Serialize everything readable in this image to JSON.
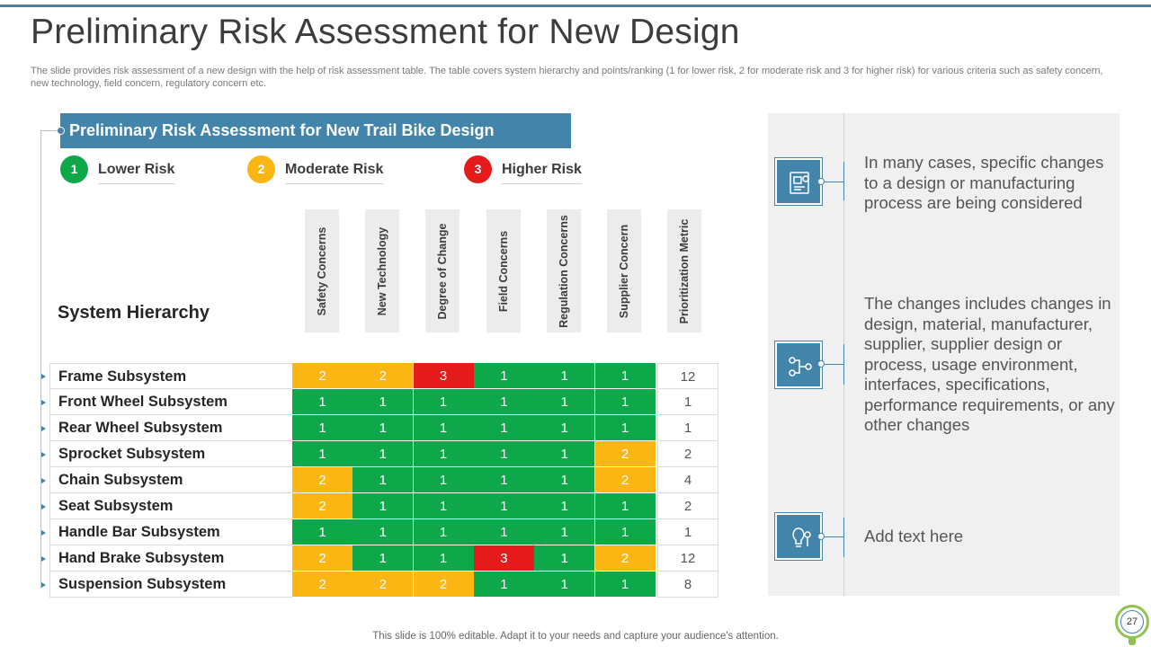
{
  "slide": {
    "title": "Preliminary Risk Assessment for New Design",
    "description": "The slide provides risk assessment of a new design with the help of risk assessment table. The table covers system hierarchy and points/ranking (1 for lower risk, 2 for moderate risk and 3 for higher risk) for various criteria such as safety concern, new technology, field concern, regulatory concern etc.",
    "footer": "This slide is 100% editable. Adapt it to your needs and capture your audience's attention.",
    "page_number": "27"
  },
  "table": {
    "banner": "Preliminary Risk Assessment for New Trail Bike Design",
    "legend": [
      {
        "number": "1",
        "label": "Lower Risk",
        "color": "#0ea84a"
      },
      {
        "number": "2",
        "label": "Moderate Risk",
        "color": "#fbb614"
      },
      {
        "number": "3",
        "label": "Higher Risk",
        "color": "#e51b1b"
      }
    ],
    "hierarchy_title": "System Hierarchy",
    "columns": [
      "Safety Concerns",
      "New Technology",
      "Degree of Change",
      "Field Concerns",
      "Regulation Concerns",
      "Supplier Concern",
      "Prioritization Metric"
    ],
    "rows": [
      {
        "name": "Frame Subsystem",
        "scores": [
          2,
          2,
          3,
          1,
          1,
          1
        ],
        "metric": "12"
      },
      {
        "name": "Front Wheel Subsystem",
        "scores": [
          1,
          1,
          1,
          1,
          1,
          1
        ],
        "metric": "1"
      },
      {
        "name": "Rear Wheel Subsystem",
        "scores": [
          1,
          1,
          1,
          1,
          1,
          1
        ],
        "metric": "1"
      },
      {
        "name": "Sprocket Subsystem",
        "scores": [
          1,
          1,
          1,
          1,
          1,
          2
        ],
        "metric": "2"
      },
      {
        "name": "Chain Subsystem",
        "scores": [
          2,
          1,
          1,
          1,
          1,
          2
        ],
        "metric": "4"
      },
      {
        "name": "Seat Subsystem",
        "scores": [
          2,
          1,
          1,
          1,
          1,
          1
        ],
        "metric": "2"
      },
      {
        "name": "Handle Bar Subsystem",
        "scores": [
          1,
          1,
          1,
          1,
          1,
          1
        ],
        "metric": "1"
      },
      {
        "name": "Hand Brake Subsystem",
        "scores": [
          2,
          1,
          1,
          3,
          1,
          2
        ],
        "metric": "12"
      },
      {
        "name": "Suspension Subsystem",
        "scores": [
          2,
          2,
          2,
          1,
          1,
          1
        ],
        "metric": "8"
      }
    ]
  },
  "right_panel": {
    "items": [
      {
        "icon": "design-document-icon",
        "text": "In many cases, specific changes to a design or manufacturing process are being considered"
      },
      {
        "icon": "process-flow-icon",
        "text": "The changes includes changes in design, material, manufacturer, supplier, supplier design or process, usage environment, interfaces, specifications, performance requirements, or any other changes"
      },
      {
        "icon": "idea-bulb-icon",
        "text": "Add text here"
      }
    ]
  },
  "colors": {
    "accent": "#4384ab",
    "low": "#0ea84a",
    "moderate": "#fbb614",
    "high": "#e51b1b"
  }
}
